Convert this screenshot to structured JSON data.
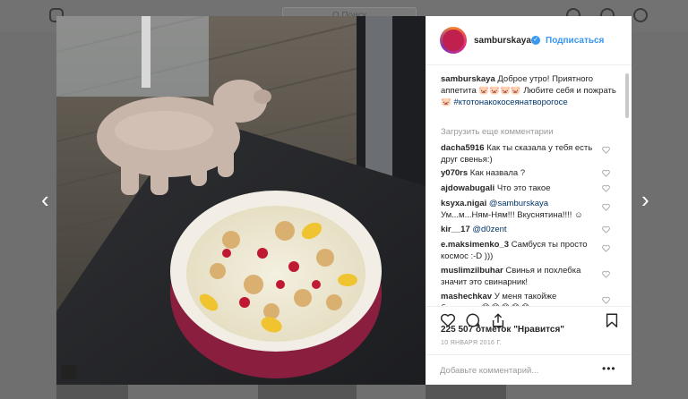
{
  "header": {
    "search_placeholder": "Q Поиск"
  },
  "post": {
    "username": "samburskaya",
    "verified_icon": "verified-badge-icon",
    "follow_label": "Подписаться",
    "caption_user": "samburskaya",
    "caption_text": "Доброе утро! Приятного аппетита 🐷🐷🐷🐷 Любите себя и пожрать🐷",
    "caption_tag": "#ктотонакокосеянатворогосе",
    "load_more": "Загрузить еще комментарии",
    "comments": [
      {
        "user": "dacha5916",
        "mention": "",
        "text": "Как ты сказала у тебя есть друг свенья:)"
      },
      {
        "user": "y070rs",
        "mention": "",
        "text": "Как назвала ?"
      },
      {
        "user": "ajdowabugali",
        "mention": "",
        "text": "Что это такое"
      },
      {
        "user": "ksyxa.nigai",
        "mention": "@samburskaya",
        "text": "Ум...м...Ням-Ням!!! Вкуснятина!!!! ☺"
      },
      {
        "user": "kir__17",
        "mention": "@d0zent",
        "text": ""
      },
      {
        "user": "e.maksimenko_3",
        "mention": "",
        "text": "Самбуся ты просто космос :-D )))"
      },
      {
        "user": "muslimzilbuhar",
        "mention": "",
        "text": "Свинья и похлебка значит это свинарник!"
      },
      {
        "user": "mashechkav",
        "mention": "",
        "text": "У меня такойже бегемотик😂😂😂😂😂"
      }
    ],
    "likes_count": "225 507",
    "likes_word": "отметок",
    "likes_suffix": "\"Нравится\"",
    "date": "10 ЯНВАРЯ 2016 Г.",
    "add_comment_placeholder": "Добавьте комментарий...",
    "more_options": "•••"
  },
  "colors": {
    "accent": "#3897f0",
    "text": "#262626",
    "muted": "#999999",
    "overlay": "#6f6f6f"
  }
}
